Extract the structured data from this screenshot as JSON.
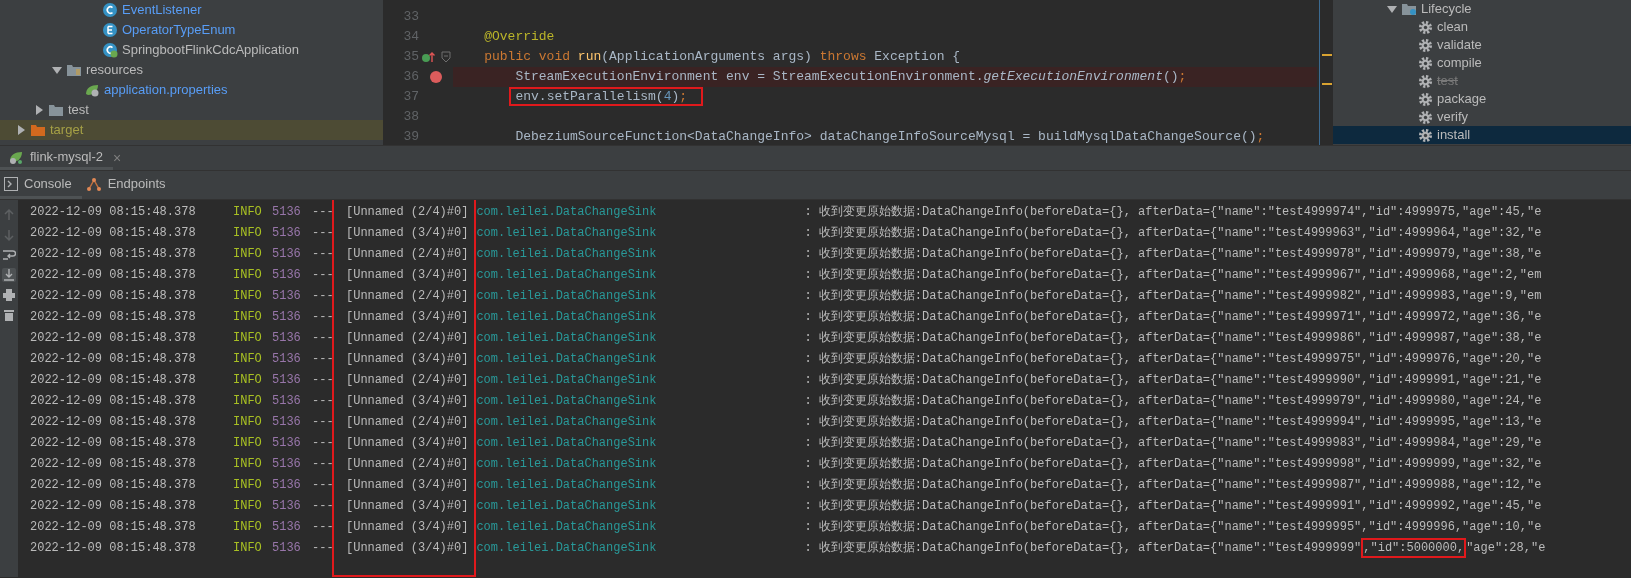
{
  "project_tree": [
    {
      "children": [
        {
          "children": [
            {
              "children": [
                {
                  "children": [
                    {
                      "label": "EventListener",
                      "kind": "class"
                    },
                    {
                      "label": "OperatorTypeEnum",
                      "kind": "enum"
                    },
                    {
                      "label": "SpringbootFlinkCdcApplication",
                      "kind": "spring-class"
                    }
                  ]
                }
              ]
            },
            {
              "label": "resources",
              "kind": "resource-folder",
              "expanded": true,
              "children": [
                {
                  "label": "application.properties",
                  "kind": "properties"
                }
              ]
            }
          ]
        },
        {
          "label": "test",
          "kind": "folder",
          "expanded": false
        }
      ]
    },
    {
      "label": "target",
      "kind": "excluded-folder",
      "expanded": false
    }
  ],
  "editor": {
    "lines": [
      {
        "number": "33"
      },
      {
        "number": "34",
        "segments": [
          {
            "text": "    @Override",
            "kind": "annotation"
          }
        ]
      },
      {
        "number": "35",
        "override": true,
        "fold": true,
        "segments": [
          {
            "text": "    public void ",
            "kind": "keyword"
          },
          {
            "text": "run",
            "kind": "method"
          },
          {
            "text": "(ApplicationArguments args) ",
            "kind": "plain"
          },
          {
            "text": "throws ",
            "kind": "keyword"
          },
          {
            "text": "Exception {",
            "kind": "plain"
          }
        ]
      },
      {
        "number": "36",
        "breakpoint": true,
        "segments": [
          {
            "text": "        StreamExecutionEnvironment env = StreamExecutionEnvironment.",
            "kind": "plain"
          },
          {
            "text": "getExecutionEnvironment",
            "kind": "static-call"
          },
          {
            "text": "()",
            "kind": "plain"
          },
          {
            "text": ";",
            "kind": "keyword"
          }
        ]
      },
      {
        "number": "37",
        "boxed": true,
        "segments": [
          {
            "text": "        env.setParallelism(",
            "kind": "plain"
          },
          {
            "text": "4",
            "kind": "number"
          },
          {
            "text": ")",
            "kind": "plain"
          },
          {
            "text": ";",
            "kind": "keyword"
          }
        ]
      },
      {
        "number": "38"
      },
      {
        "number": "39",
        "segments": [
          {
            "text": "        DebeziumSourceFunction<DataChangeInfo> dataChangeInfoSourceMysql = buildMysqlDataChangeSource()",
            "kind": "plain"
          },
          {
            "text": ";",
            "kind": "keyword"
          }
        ]
      }
    ]
  },
  "maven": {
    "label": "Lifecycle",
    "expanded": true,
    "children": [
      {
        "label": "clean",
        "skipped": false,
        "selected": false
      },
      {
        "label": "validate",
        "skipped": false,
        "selected": false
      },
      {
        "label": "compile",
        "skipped": false,
        "selected": false
      },
      {
        "label": "test",
        "skipped": true,
        "selected": false
      },
      {
        "label": "package",
        "skipped": false,
        "selected": false
      },
      {
        "label": "verify",
        "skipped": false,
        "selected": false
      },
      {
        "label": "install",
        "skipped": false,
        "selected": true
      }
    ]
  },
  "run_tabs": [
    {
      "label": "flink-mysql-2",
      "selected": true,
      "close": "×"
    }
  ],
  "console_tabs": [
    {
      "label": "Console",
      "kind": "console",
      "selected": true
    },
    {
      "label": "Endpoints",
      "kind": "endpoints",
      "selected": false
    }
  ],
  "log": {
    "thread_column_boxed": true,
    "rows": [
      {
        "timestamp": "2022-12-09 08:15:48.378",
        "level": "INFO",
        "pid": "5136",
        "separator": "---",
        "thread": "[Unnamed (2/4)#0]",
        "logger": "com.leilei.DataChangeSink",
        "message": [
          {
            "text": ": 收到变更原始数据:DataChangeInfo(beforeData={}, afterData={\"name\":\"test4999974\",\"id\":4999975,\"age\":45,\"e",
            "boxed": false
          }
        ]
      },
      {
        "timestamp": "2022-12-09 08:15:48.378",
        "level": "INFO",
        "pid": "5136",
        "separator": "---",
        "thread": "[Unnamed (3/4)#0]",
        "logger": "com.leilei.DataChangeSink",
        "message": [
          {
            "text": ": 收到变更原始数据:DataChangeInfo(beforeData={}, afterData={\"name\":\"test4999963\",\"id\":4999964,\"age\":32,\"e",
            "boxed": false
          }
        ]
      },
      {
        "timestamp": "2022-12-09 08:15:48.378",
        "level": "INFO",
        "pid": "5136",
        "separator": "---",
        "thread": "[Unnamed (2/4)#0]",
        "logger": "com.leilei.DataChangeSink",
        "message": [
          {
            "text": ": 收到变更原始数据:DataChangeInfo(beforeData={}, afterData={\"name\":\"test4999978\",\"id\":4999979,\"age\":38,\"e",
            "boxed": false
          }
        ]
      },
      {
        "timestamp": "2022-12-09 08:15:48.378",
        "level": "INFO",
        "pid": "5136",
        "separator": "---",
        "thread": "[Unnamed (3/4)#0]",
        "logger": "com.leilei.DataChangeSink",
        "message": [
          {
            "text": ": 收到变更原始数据:DataChangeInfo(beforeData={}, afterData={\"name\":\"test4999967\",\"id\":4999968,\"age\":2,\"em",
            "boxed": false
          }
        ]
      },
      {
        "timestamp": "2022-12-09 08:15:48.378",
        "level": "INFO",
        "pid": "5136",
        "separator": "---",
        "thread": "[Unnamed (2/4)#0]",
        "logger": "com.leilei.DataChangeSink",
        "message": [
          {
            "text": ": 收到变更原始数据:DataChangeInfo(beforeData={}, afterData={\"name\":\"test4999982\",\"id\":4999983,\"age\":9,\"em",
            "boxed": false
          }
        ]
      },
      {
        "timestamp": "2022-12-09 08:15:48.378",
        "level": "INFO",
        "pid": "5136",
        "separator": "---",
        "thread": "[Unnamed (3/4)#0]",
        "logger": "com.leilei.DataChangeSink",
        "message": [
          {
            "text": ": 收到变更原始数据:DataChangeInfo(beforeData={}, afterData={\"name\":\"test4999971\",\"id\":4999972,\"age\":36,\"e",
            "boxed": false
          }
        ]
      },
      {
        "timestamp": "2022-12-09 08:15:48.378",
        "level": "INFO",
        "pid": "5136",
        "separator": "---",
        "thread": "[Unnamed (2/4)#0]",
        "logger": "com.leilei.DataChangeSink",
        "message": [
          {
            "text": ": 收到变更原始数据:DataChangeInfo(beforeData={}, afterData={\"name\":\"test4999986\",\"id\":4999987,\"age\":38,\"e",
            "boxed": false
          }
        ]
      },
      {
        "timestamp": "2022-12-09 08:15:48.378",
        "level": "INFO",
        "pid": "5136",
        "separator": "---",
        "thread": "[Unnamed (3/4)#0]",
        "logger": "com.leilei.DataChangeSink",
        "message": [
          {
            "text": ": 收到变更原始数据:DataChangeInfo(beforeData={}, afterData={\"name\":\"test4999975\",\"id\":4999976,\"age\":20,\"e",
            "boxed": false
          }
        ]
      },
      {
        "timestamp": "2022-12-09 08:15:48.378",
        "level": "INFO",
        "pid": "5136",
        "separator": "---",
        "thread": "[Unnamed (2/4)#0]",
        "logger": "com.leilei.DataChangeSink",
        "message": [
          {
            "text": ": 收到变更原始数据:DataChangeInfo(beforeData={}, afterData={\"name\":\"test4999990\",\"id\":4999991,\"age\":21,\"e",
            "boxed": false
          }
        ]
      },
      {
        "timestamp": "2022-12-09 08:15:48.378",
        "level": "INFO",
        "pid": "5136",
        "separator": "---",
        "thread": "[Unnamed (3/4)#0]",
        "logger": "com.leilei.DataChangeSink",
        "message": [
          {
            "text": ": 收到变更原始数据:DataChangeInfo(beforeData={}, afterData={\"name\":\"test4999979\",\"id\":4999980,\"age\":24,\"e",
            "boxed": false
          }
        ]
      },
      {
        "timestamp": "2022-12-09 08:15:48.378",
        "level": "INFO",
        "pid": "5136",
        "separator": "---",
        "thread": "[Unnamed (2/4)#0]",
        "logger": "com.leilei.DataChangeSink",
        "message": [
          {
            "text": ": 收到变更原始数据:DataChangeInfo(beforeData={}, afterData={\"name\":\"test4999994\",\"id\":4999995,\"age\":13,\"e",
            "boxed": false
          }
        ]
      },
      {
        "timestamp": "2022-12-09 08:15:48.378",
        "level": "INFO",
        "pid": "5136",
        "separator": "---",
        "thread": "[Unnamed (3/4)#0]",
        "logger": "com.leilei.DataChangeSink",
        "message": [
          {
            "text": ": 收到变更原始数据:DataChangeInfo(beforeData={}, afterData={\"name\":\"test4999983\",\"id\":4999984,\"age\":29,\"e",
            "boxed": false
          }
        ]
      },
      {
        "timestamp": "2022-12-09 08:15:48.378",
        "level": "INFO",
        "pid": "5136",
        "separator": "---",
        "thread": "[Unnamed (2/4)#0]",
        "logger": "com.leilei.DataChangeSink",
        "message": [
          {
            "text": ": 收到变更原始数据:DataChangeInfo(beforeData={}, afterData={\"name\":\"test4999998\",\"id\":4999999,\"age\":32,\"e",
            "boxed": false
          }
        ]
      },
      {
        "timestamp": "2022-12-09 08:15:48.378",
        "level": "INFO",
        "pid": "5136",
        "separator": "---",
        "thread": "[Unnamed (3/4)#0]",
        "logger": "com.leilei.DataChangeSink",
        "message": [
          {
            "text": ": 收到变更原始数据:DataChangeInfo(beforeData={}, afterData={\"name\":\"test4999987\",\"id\":4999988,\"age\":12,\"e",
            "boxed": false
          }
        ]
      },
      {
        "timestamp": "2022-12-09 08:15:48.378",
        "level": "INFO",
        "pid": "5136",
        "separator": "---",
        "thread": "[Unnamed (3/4)#0]",
        "logger": "com.leilei.DataChangeSink",
        "message": [
          {
            "text": ": 收到变更原始数据:DataChangeInfo(beforeData={}, afterData={\"name\":\"test4999991\",\"id\":4999992,\"age\":45,\"e",
            "boxed": false
          }
        ]
      },
      {
        "timestamp": "2022-12-09 08:15:48.378",
        "level": "INFO",
        "pid": "5136",
        "separator": "---",
        "thread": "[Unnamed (3/4)#0]",
        "logger": "com.leilei.DataChangeSink",
        "message": [
          {
            "text": ": 收到变更原始数据:DataChangeInfo(beforeData={}, afterData={\"name\":\"test4999995\",\"id\":4999996,\"age\":10,\"e",
            "boxed": false
          }
        ]
      },
      {
        "timestamp": "2022-12-09 08:15:48.378",
        "level": "INFO",
        "pid": "5136",
        "separator": "---",
        "thread": "[Unnamed (3/4)#0]",
        "logger": "com.leilei.DataChangeSink",
        "message": [
          {
            "text": ": 收到变更原始数据:DataChangeInfo(beforeData={}, afterData={\"name\":\"test4999999\"",
            "boxed": false
          },
          {
            "text": ",\"id\":5000000,",
            "boxed": true
          },
          {
            "text": "\"age\":28,\"e",
            "boxed": false
          }
        ]
      }
    ]
  }
}
